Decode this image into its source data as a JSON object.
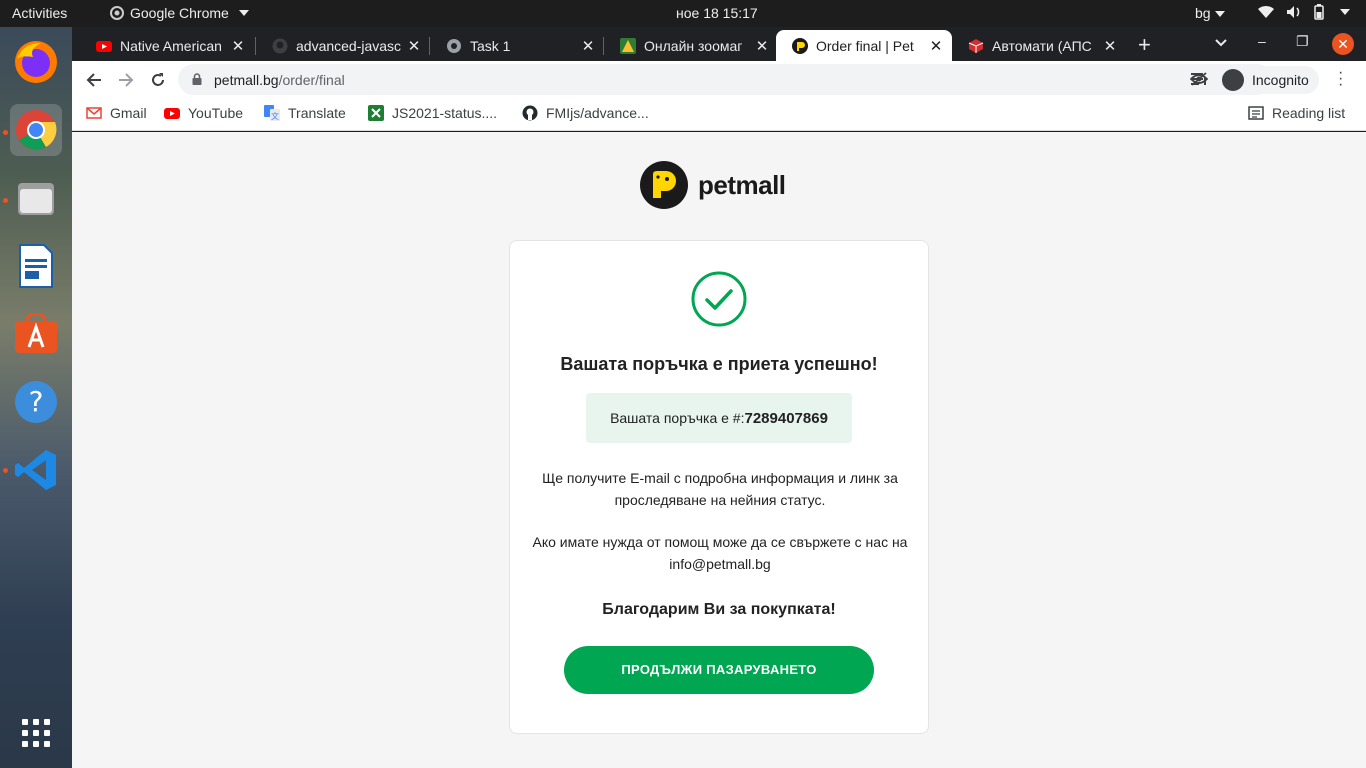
{
  "system": {
    "activities": "Activities",
    "app_name": "Google Chrome",
    "clock": "ное 18  15:17",
    "keyboard_lang": "bg"
  },
  "tabs": [
    {
      "title": "Native American",
      "favicon": "youtube-icon",
      "active": false
    },
    {
      "title": "advanced-javasc",
      "favicon": "github-icon",
      "active": false
    },
    {
      "title": "Task 1",
      "favicon": "globe-icon",
      "active": false
    },
    {
      "title": "Онлайн зоомаг",
      "favicon": "zoomag-icon",
      "active": false
    },
    {
      "title": "Order final | Pet",
      "favicon": "petmall-icon",
      "active": true
    },
    {
      "title": "Автомати (АПС",
      "favicon": "cube-icon",
      "active": false
    }
  ],
  "omnibox": {
    "domain": "petmall.bg",
    "path": "/order/final"
  },
  "profile": {
    "label": "Incognito"
  },
  "bookmarks": [
    {
      "label": "Gmail",
      "icon": "gmail-icon"
    },
    {
      "label": "YouTube",
      "icon": "youtube-icon"
    },
    {
      "label": "Translate",
      "icon": "translate-icon"
    },
    {
      "label": "JS2021-status....",
      "icon": "sheets-icon"
    },
    {
      "label": "FMIjs/advance...",
      "icon": "github-icon"
    }
  ],
  "reading_list": "Reading list",
  "page": {
    "logo_text": "petmall",
    "heading": "Вашата поръчка е приета успешно!",
    "order_label": "Вашата поръчка е #:",
    "order_number": "7289407869",
    "email_info": "Ще получите E-mail с подробна информация и линк за проследяване на нейния статус.",
    "help_info": "Ако имате нужда от помощ може да се свържете с нас на info@petmall.bg",
    "thanks": "Благодарим Ви за покупката!",
    "continue_button": "ПРОДЪЛЖИ ПАЗАРУВАНЕТО"
  },
  "colors": {
    "accent_green": "#00a651",
    "order_box_bg": "#e8f5ee",
    "brand_yellow": "#ffd600"
  }
}
